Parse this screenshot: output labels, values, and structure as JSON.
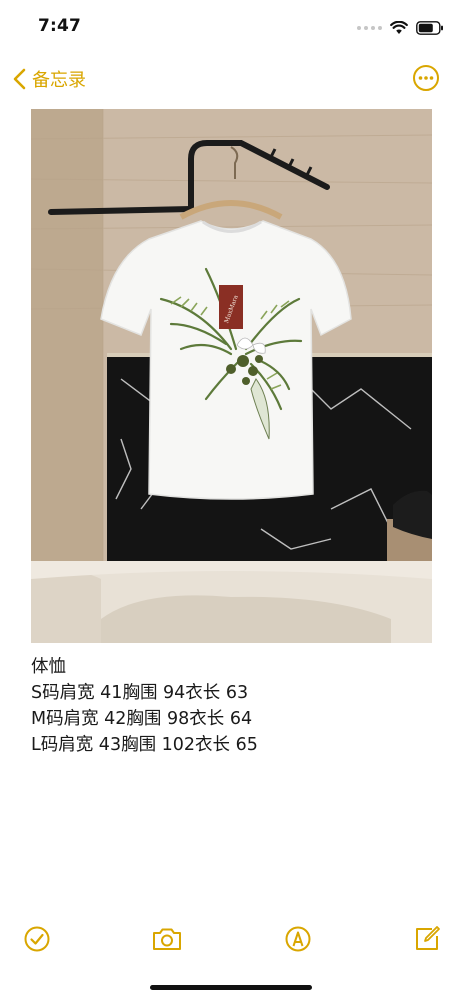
{
  "status_bar": {
    "time": "7:47"
  },
  "nav": {
    "back_label": "备忘录",
    "back_icon": "chevron-left-icon",
    "more_icon": "ellipsis-circle-icon"
  },
  "photo": {
    "description_icon": "t-shirt-photo",
    "brand_tag": "MaxMara"
  },
  "note": {
    "lines": [
      "体恤",
      "S码肩宽 41胸围 94衣长 63",
      "M码肩宽 42胸围 98衣长 64",
      "L码肩宽 43胸围 102衣长 65"
    ]
  },
  "toolbar": {
    "icons": [
      "checklist-icon",
      "camera-icon",
      "markup-pen-icon",
      "compose-icon"
    ]
  },
  "colors": {
    "accent": "#d9a600"
  }
}
